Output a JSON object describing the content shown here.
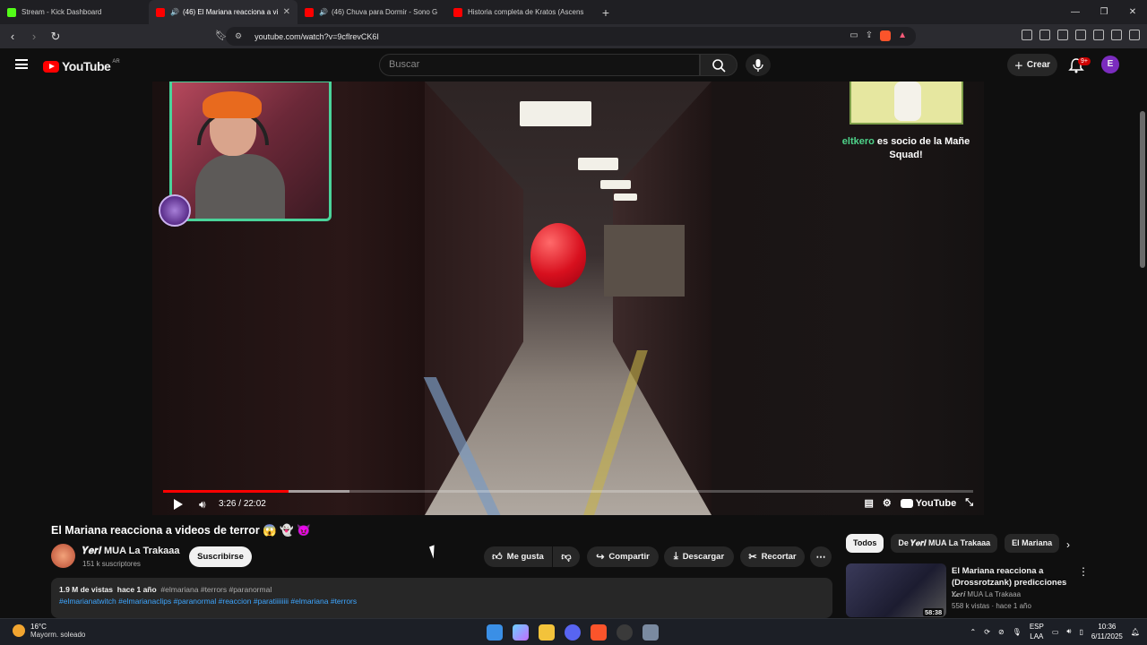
{
  "browser": {
    "tabs": [
      {
        "title": "Stream - Kick Dashboard",
        "favicon_color": "#53fc18",
        "active": false,
        "audio": false
      },
      {
        "title": "(46) El Mariana reacciona a vi",
        "favicon_color": "#ff0000",
        "active": true,
        "audio": true
      },
      {
        "title": "(46) Chuva para Dormir - Sono G",
        "favicon_color": "#ff0000",
        "active": false,
        "audio": true
      },
      {
        "title": "Historia completa de Kratos (Ascens",
        "favicon_color": "#ff0000",
        "active": false,
        "audio": false
      }
    ],
    "url": "youtube.com/watch?v=9cflrevCK6I"
  },
  "youtube": {
    "logo_text": "YouTube",
    "country_code": "AR",
    "search_placeholder": "Buscar",
    "create_label": "Crear",
    "notif_badge": "9+",
    "avatar_letter": "E"
  },
  "player": {
    "current_time": "3:26",
    "duration": "22:02",
    "time_sep": " / ",
    "progress_fraction": 0.155,
    "buffered_fraction": 0.23,
    "logo_text": "YouTube",
    "overlay_name": "eltkero",
    "overlay_message": " es socio de la Mañe Squad!"
  },
  "video": {
    "title": "El Mariana reacciona a videos de terror 😱 👻 😈",
    "channel_name": "𝒀𝒆𝒓𝒊 MUA La Trakaaa",
    "channel_subs": "151 k suscriptores",
    "subscribe_label": "Suscribirse",
    "actions": {
      "like": "Me gusta",
      "share": "Compartir",
      "download": "Descargar",
      "clip": "Recortar"
    },
    "description": {
      "views": "1.9 M de vistas",
      "age": "hace 1 año",
      "tags_line1": "#elmariana #terrors #paranormal",
      "tags_line2": "#elmarianatwitch #elmarianaclips #paranormal #reaccion #paratiiiiiiii #elmariana #terrors"
    }
  },
  "sidebar": {
    "chips": [
      "Todos",
      "De 𝒀𝒆𝒓𝒊 MUA La Trakaaa",
      "El Mariana"
    ],
    "recommendation": {
      "title": "El Mariana reacciona a (Drossrotzank) predicciones ...",
      "channel": "𝒀𝒆𝒓𝒊 MUA La Trakaaa",
      "meta": "558 k vistas · hace 1 año",
      "duration": "58:38"
    }
  },
  "taskbar": {
    "temp": "16°C",
    "weather": "Mayorm. soleado",
    "lang1": "ESP",
    "lang2": "LAA",
    "time": "10:36",
    "date": "6/11/2025"
  }
}
